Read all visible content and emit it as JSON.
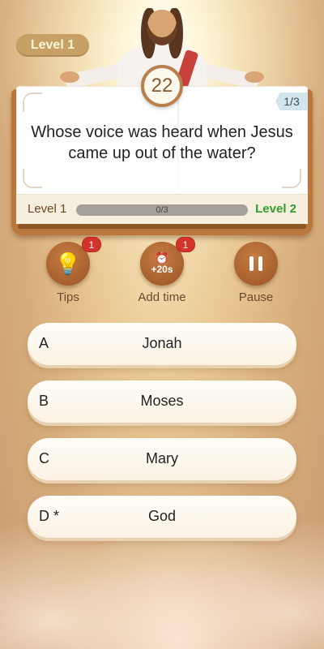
{
  "header": {
    "level_pill": "Level 1",
    "timer": "22"
  },
  "card": {
    "counter": "1/3",
    "question": "Whose voice was heard when Jesus came up out of the water?",
    "level_from": "Level 1",
    "level_to": "Level 2",
    "progress_text": "0/3",
    "progress_fraction": 0
  },
  "actions": [
    {
      "label": "Tips",
      "badge": "1",
      "icon": "lightbulb-icon"
    },
    {
      "label": "Add time",
      "badge": "1",
      "icon": "clock-icon",
      "icon_text": "+20s"
    },
    {
      "label": "Pause",
      "icon": "pause-icon"
    }
  ],
  "answers": [
    {
      "letter": "A",
      "text": "Jonah"
    },
    {
      "letter": "B",
      "text": "Moses"
    },
    {
      "letter": "C",
      "text": "Mary"
    },
    {
      "letter": "D *",
      "text": "God"
    }
  ],
  "colors": {
    "accent_brown": "#a6602d",
    "badge_red": "#d2332b",
    "level_green": "#2f9e2f"
  }
}
